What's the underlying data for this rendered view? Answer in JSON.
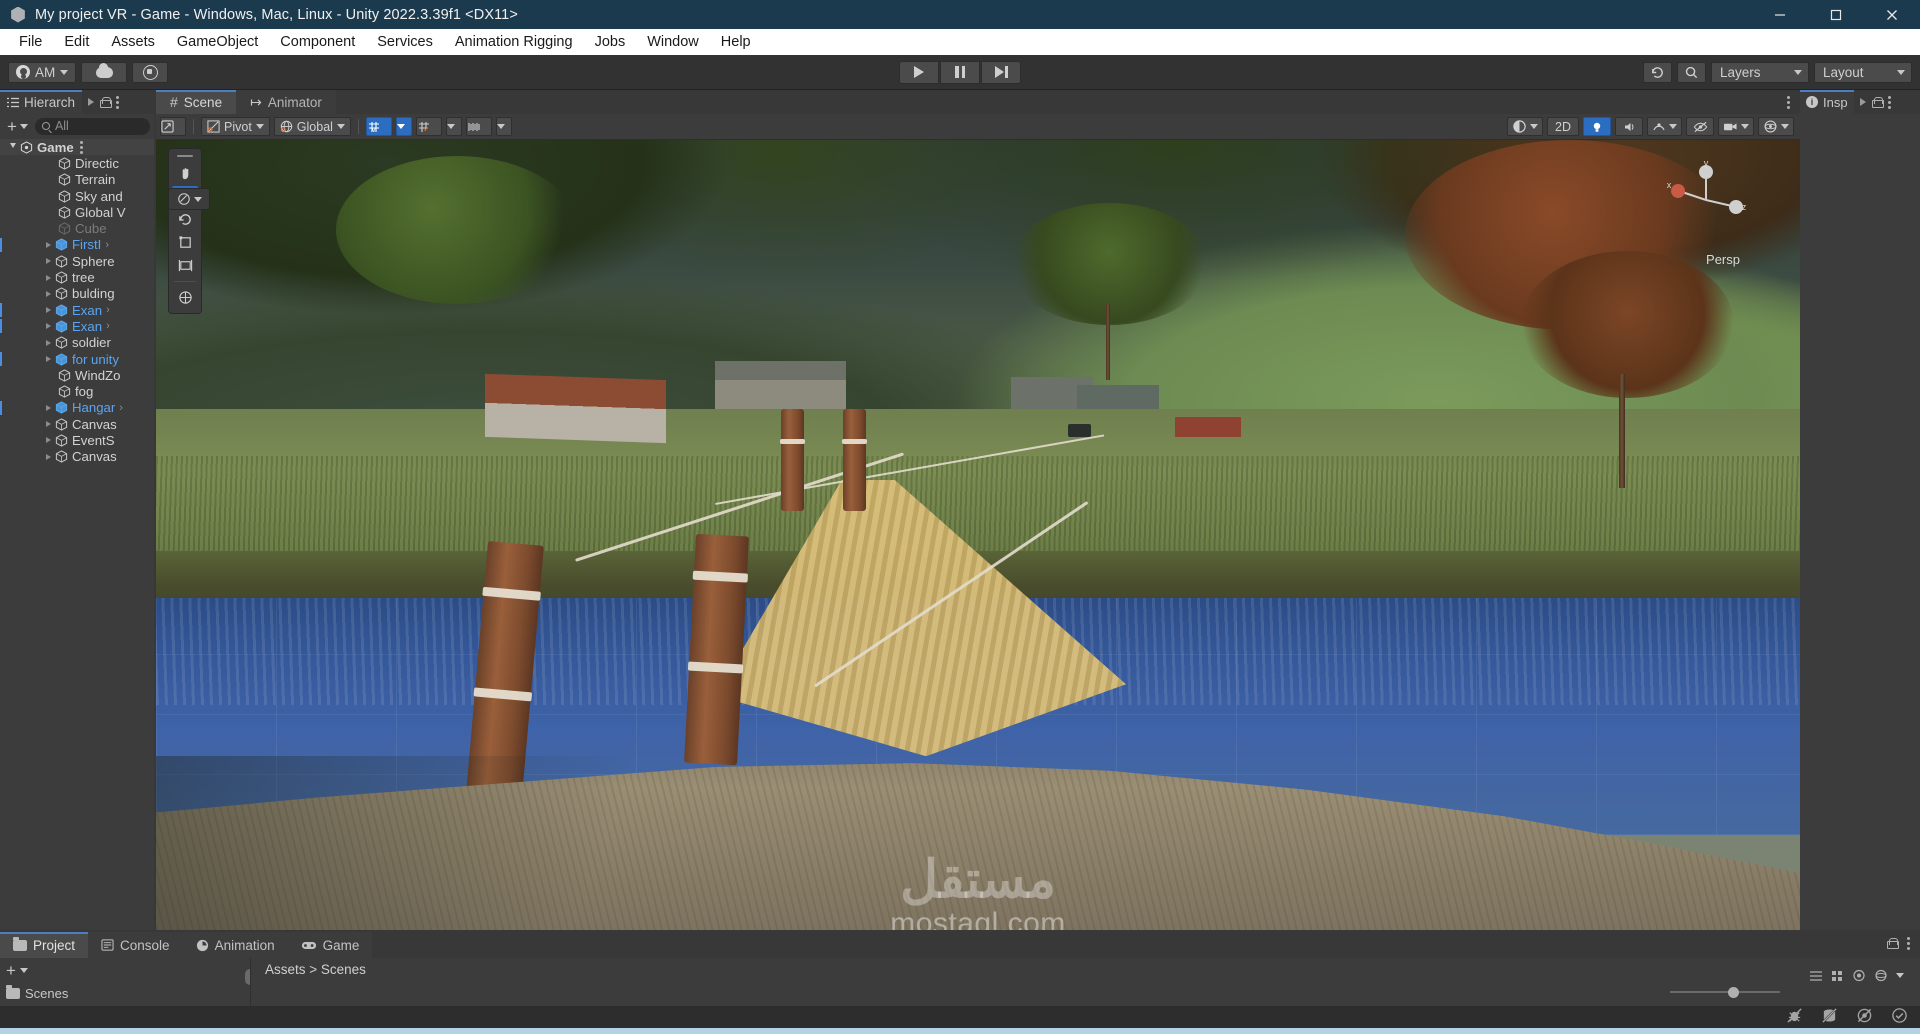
{
  "window": {
    "title": "My project VR - Game - Windows, Mac, Linux - Unity 2022.3.39f1 <DX11>",
    "app_icon": "unity-logo-icon",
    "minimize": "minimize-icon",
    "maximize": "maximize-icon",
    "close": "close-icon"
  },
  "menubar": {
    "items": [
      "File",
      "Edit",
      "Assets",
      "GameObject",
      "Component",
      "Services",
      "Animation Rigging",
      "Jobs",
      "Window",
      "Help"
    ]
  },
  "toolbar": {
    "account_label": "AM",
    "cloud_icon": "cloud-icon",
    "collab_icon": "collab-icon",
    "play": "play-icon",
    "pause": "pause-icon",
    "step": "step-icon",
    "history_icon": "undo-history-icon",
    "search_icon": "search-icon",
    "layers_label": "Layers",
    "layout_label": "Layout"
  },
  "hierarchy": {
    "tab_label": "Hierarch",
    "tab_icon": "hierarchy-icon",
    "lock_icon": "lock-icon",
    "kebab_icon": "kebab-menu-icon",
    "add_label": "+",
    "search_placeholder": "All",
    "root": {
      "label": "Game",
      "icon": "unity-scene-icon"
    },
    "items": [
      {
        "label": "Directic",
        "indent": 1,
        "expandable": false,
        "selected": false,
        "dim": false,
        "prefab": false
      },
      {
        "label": "Terrain",
        "indent": 1,
        "expandable": false,
        "selected": false,
        "dim": false,
        "prefab": false
      },
      {
        "label": "Sky and",
        "indent": 1,
        "expandable": false,
        "selected": false,
        "dim": false,
        "prefab": false
      },
      {
        "label": "Global V",
        "indent": 1,
        "expandable": false,
        "selected": false,
        "dim": false,
        "prefab": false
      },
      {
        "label": "Cube",
        "indent": 1,
        "expandable": false,
        "selected": false,
        "dim": true,
        "prefab": false
      },
      {
        "label": "FirstI",
        "indent": 1,
        "expandable": true,
        "selected": true,
        "dim": false,
        "prefab": true,
        "overflow": true
      },
      {
        "label": "Sphere",
        "indent": 1,
        "expandable": true,
        "selected": false,
        "dim": false,
        "prefab": false
      },
      {
        "label": "tree",
        "indent": 1,
        "expandable": true,
        "selected": false,
        "dim": false,
        "prefab": false
      },
      {
        "label": "bulding",
        "indent": 1,
        "expandable": true,
        "selected": false,
        "dim": false,
        "prefab": false
      },
      {
        "label": "Exan",
        "indent": 1,
        "expandable": true,
        "selected": true,
        "dim": false,
        "prefab": true,
        "overflow": true
      },
      {
        "label": "Exan",
        "indent": 1,
        "expandable": true,
        "selected": true,
        "dim": false,
        "prefab": true,
        "overflow": true
      },
      {
        "label": "soldier",
        "indent": 1,
        "expandable": true,
        "selected": false,
        "dim": false,
        "prefab": false
      },
      {
        "label": "for unity",
        "indent": 1,
        "expandable": true,
        "selected": true,
        "dim": false,
        "prefab": true
      },
      {
        "label": "WindZo",
        "indent": 1,
        "expandable": false,
        "selected": false,
        "dim": false,
        "prefab": false
      },
      {
        "label": "fog",
        "indent": 1,
        "expandable": false,
        "selected": false,
        "dim": false,
        "prefab": false
      },
      {
        "label": "Hangar",
        "indent": 1,
        "expandable": true,
        "selected": true,
        "dim": false,
        "prefab": true,
        "overflow": true
      },
      {
        "label": "Canvas",
        "indent": 1,
        "expandable": true,
        "selected": false,
        "dim": false,
        "prefab": false
      },
      {
        "label": "EventS",
        "indent": 1,
        "expandable": true,
        "selected": false,
        "dim": false,
        "prefab": false
      },
      {
        "label": "Canvas",
        "indent": 1,
        "expandable": true,
        "selected": false,
        "dim": false,
        "prefab": false
      }
    ]
  },
  "scene": {
    "tabs": [
      {
        "label": "Scene",
        "icon": "grid-hash-icon",
        "active": true
      },
      {
        "label": "Animator",
        "icon": "animator-icon",
        "active": false
      }
    ],
    "kebab_icon": "kebab-menu-icon",
    "toolbar": {
      "pivot_label": "Pivot",
      "pivot_icon": "pivot-icon",
      "global_label": "Global",
      "global_icon": "globe-icon",
      "grid_snap_icon": "grid-snapping-icon",
      "snap_increment_icon": "snap-increment-icon",
      "grid_visual_icon": "grid-visual-icon",
      "draw_mode_icon": "shading-mode-icon",
      "mode_2d_label": "2D",
      "lighting_icon": "lighting-icon",
      "audio_icon": "audio-icon",
      "fx_icon": "effects-icon",
      "hidden_icon": "hidden-objects-icon",
      "camera_icon": "scene-camera-icon",
      "gizmos_icon": "gizmos-icon"
    },
    "tools": [
      {
        "name": "hand-tool",
        "icon": "hand-icon",
        "active": false
      },
      {
        "name": "move-tool",
        "icon": "move-arrows-icon",
        "active": true
      },
      {
        "name": "rotate-tool",
        "icon": "rotate-icon",
        "active": false
      },
      {
        "name": "scale-tool",
        "icon": "scale-icon",
        "active": false
      },
      {
        "name": "rect-tool",
        "icon": "rect-transform-icon",
        "active": false
      },
      {
        "name": "transform-tool",
        "icon": "combined-transform-icon",
        "active": false
      }
    ],
    "view_options_icon": "view-options-icon",
    "gizmo": {
      "label": "Persp",
      "x_color": "#d05a4a",
      "y_color": "#9bcf3f",
      "z_color": "#4a8fd0",
      "x_label": "x",
      "y_label": "y",
      "z_label": "z"
    },
    "watermark": {
      "arabic": "مستقل",
      "latin": "mostaql.com"
    }
  },
  "inspector": {
    "tab_label": "Insp",
    "info_icon": "info-icon",
    "arrow_icon": "expand-arrow-icon",
    "lock_icon": "lock-icon",
    "kebab_icon": "kebab-menu-icon"
  },
  "bottom_panel": {
    "tabs": [
      {
        "label": "Project",
        "icon": "folder-icon",
        "active": true
      },
      {
        "label": "Console",
        "icon": "console-icon",
        "active": false
      },
      {
        "label": "Animation",
        "icon": "clock-icon",
        "active": false
      },
      {
        "label": "Game",
        "icon": "gamepad-icon",
        "active": false
      }
    ],
    "lock_icon": "lock-icon",
    "kebab_icon": "kebab-menu-icon",
    "add_label": "+",
    "scenes_label": "Scenes",
    "asset_label": "Assets > Scenes",
    "view_icons": [
      "list-view-icon",
      "grid-view-icon"
    ],
    "zoom_slider_value": 52
  },
  "statusbar": {
    "icons": [
      "bug-mute-icon",
      "database-mute-icon",
      "collab-mute-icon",
      "check-circle-icon"
    ]
  },
  "colors": {
    "accent_blue": "#4b7ec2",
    "title_bg": "#1b3a4d",
    "panel_bg": "#3c3c3c",
    "chrome_bg": "#383838",
    "selected_text": "#59a5f5"
  }
}
